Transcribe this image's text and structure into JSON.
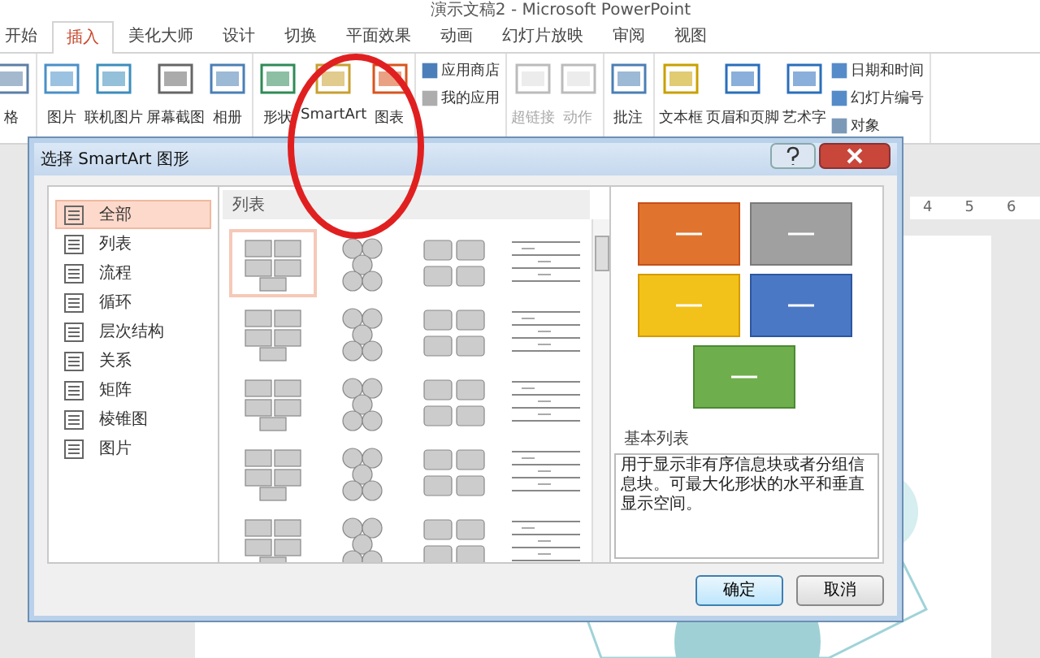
{
  "window": {
    "title": "演示文稿2 - Microsoft PowerPoint"
  },
  "tabs": [
    {
      "label": "开始",
      "selected": false
    },
    {
      "label": "插入",
      "selected": true
    },
    {
      "label": "美化大师",
      "selected": false
    },
    {
      "label": "设计",
      "selected": false
    },
    {
      "label": "切换",
      "selected": false
    },
    {
      "label": "平面效果",
      "selected": false
    },
    {
      "label": "动画",
      "selected": false
    },
    {
      "label": "幻灯片放映",
      "selected": false
    },
    {
      "label": "审阅",
      "selected": false
    },
    {
      "label": "视图",
      "selected": false
    }
  ],
  "ribbon": {
    "groups": [
      {
        "items": [
          {
            "label": "格",
            "kind": "large",
            "disabled": false
          }
        ]
      },
      {
        "items": [
          {
            "label": "图片",
            "kind": "large",
            "disabled": false
          },
          {
            "label": "联机图片",
            "kind": "large",
            "disabled": false
          },
          {
            "label": "屏幕截图",
            "kind": "large",
            "disabled": false
          },
          {
            "label": "相册",
            "kind": "large",
            "disabled": false
          }
        ]
      },
      {
        "items": [
          {
            "label": "形状",
            "kind": "large",
            "disabled": false
          },
          {
            "label": "SmartArt",
            "kind": "large",
            "disabled": false
          },
          {
            "label": "图表",
            "kind": "large",
            "disabled": false
          }
        ]
      },
      {
        "items": [
          {
            "label": "应用商店",
            "kind": "small",
            "disabled": false
          },
          {
            "label": "我的应用",
            "kind": "small",
            "disabled": false
          }
        ]
      },
      {
        "items": [
          {
            "label": "超链接",
            "kind": "large",
            "disabled": true
          },
          {
            "label": "动作",
            "kind": "large",
            "disabled": true
          }
        ]
      },
      {
        "items": [
          {
            "label": "批注",
            "kind": "large",
            "disabled": false
          }
        ]
      },
      {
        "items": [
          {
            "label": "文本框",
            "kind": "large",
            "disabled": false
          },
          {
            "label": "页眉和页脚",
            "kind": "large",
            "disabled": false
          },
          {
            "label": "艺术字",
            "kind": "large",
            "disabled": false
          },
          {
            "label": "日期和时间",
            "kind": "small",
            "disabled": false
          },
          {
            "label": "幻灯片编号",
            "kind": "small",
            "disabled": false
          },
          {
            "label": "对象",
            "kind": "small",
            "disabled": false
          }
        ]
      }
    ]
  },
  "ruler": {
    "marks": [
      "4",
      "5",
      "6"
    ]
  },
  "dialog": {
    "title": "选择 SmartArt 图形",
    "categories": [
      {
        "label": "全部",
        "selected": true
      },
      {
        "label": "列表",
        "selected": false
      },
      {
        "label": "流程",
        "selected": false
      },
      {
        "label": "循环",
        "selected": false
      },
      {
        "label": "层次结构",
        "selected": false
      },
      {
        "label": "关系",
        "selected": false
      },
      {
        "label": "矩阵",
        "selected": false
      },
      {
        "label": "棱锥图",
        "selected": false
      },
      {
        "label": "图片",
        "selected": false
      }
    ],
    "gallery": {
      "heading": "列表",
      "items": [
        {
          "selected": true
        },
        {
          "selected": false
        },
        {
          "selected": false
        },
        {
          "selected": false
        },
        {
          "selected": false
        },
        {
          "selected": false
        },
        {
          "selected": false
        },
        {
          "selected": false
        },
        {
          "selected": false
        },
        {
          "selected": false
        },
        {
          "selected": false
        },
        {
          "selected": false
        },
        {
          "selected": false
        },
        {
          "selected": false
        },
        {
          "selected": false
        },
        {
          "selected": false
        },
        {
          "selected": false
        },
        {
          "selected": false
        },
        {
          "selected": false
        },
        {
          "selected": false
        }
      ]
    },
    "preview": {
      "title": "基本列表",
      "description": "用于显示非有序信息块或者分组信息块。可最大化形状的水平和垂直显示空间。"
    },
    "buttons": [
      {
        "label": "确定",
        "kind": "default"
      },
      {
        "label": "取消",
        "kind": "normal"
      }
    ]
  }
}
